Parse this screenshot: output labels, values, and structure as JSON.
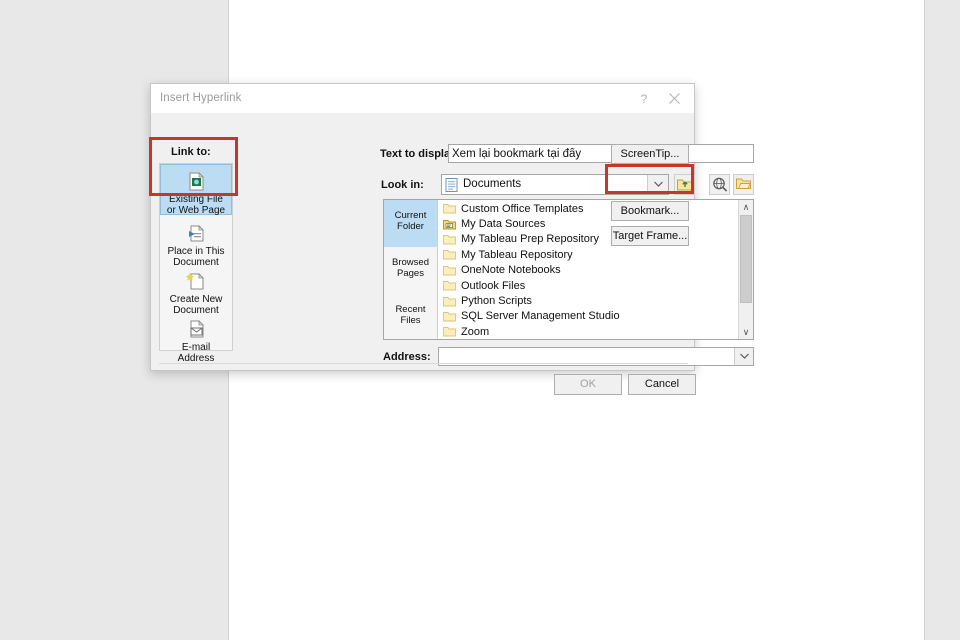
{
  "window": {
    "title": "Insert Hyperlink",
    "help_icon": "question-mark-icon",
    "help_label": "?",
    "close_icon": "close-icon"
  },
  "labels": {
    "link_to": "Link to:",
    "text_to_display": "Text to display:",
    "look_in": "Look in:",
    "address": "Address:"
  },
  "fields": {
    "text_to_display_value": "Xem lại bookmark tại đẩy",
    "text_to_display_placeholder": "",
    "look_in_value": "Documents",
    "address_value": "",
    "address_placeholder": ""
  },
  "link_to_items": [
    {
      "label_line1": "Existing File",
      "label_line2": "or Web Page",
      "icon": "existing-file-or-web-page-icon",
      "selected": true
    },
    {
      "label_line1": "Place in This",
      "label_line2": "Document",
      "icon": "place-in-this-document-icon",
      "selected": false
    },
    {
      "label_line1": "Create New",
      "label_line2": "Document",
      "icon": "create-new-document-icon",
      "selected": false
    },
    {
      "label_line1": "E-mail",
      "label_line2": "Address",
      "icon": "email-address-icon",
      "selected": false
    }
  ],
  "side_tabs": [
    {
      "line1": "Current",
      "line2": "Folder",
      "selected": true
    },
    {
      "line1": "Browsed",
      "line2": "Pages",
      "selected": false
    },
    {
      "line1": "Recent",
      "line2": "Files",
      "selected": false
    }
  ],
  "file_list": [
    {
      "name": "Custom Office Templates",
      "icon": "folder-icon"
    },
    {
      "name": "My Data Sources",
      "icon": "data-sources-folder-icon"
    },
    {
      "name": "My Tableau Prep Repository",
      "icon": "folder-icon"
    },
    {
      "name": "My Tableau Repository",
      "icon": "folder-icon"
    },
    {
      "name": "OneNote Notebooks",
      "icon": "folder-icon"
    },
    {
      "name": "Outlook Files",
      "icon": "folder-icon"
    },
    {
      "name": "Python Scripts",
      "icon": "folder-icon"
    },
    {
      "name": "SQL Server Management Studio",
      "icon": "folder-icon"
    },
    {
      "name": "Zoom",
      "icon": "folder-icon"
    }
  ],
  "toolbar_icons": [
    {
      "name": "up-one-folder-icon"
    },
    {
      "name": "browse-the-web-icon"
    },
    {
      "name": "browse-for-file-icon"
    }
  ],
  "buttons": {
    "screentip": "ScreenTip...",
    "bookmark": "Bookmark...",
    "target_frame": "Target Frame...",
    "ok": "OK",
    "cancel": "Cancel"
  },
  "scrollbar": {
    "up_arrow": "∧",
    "down_arrow": "∨"
  },
  "combo_arrow": "⌄",
  "colors": {
    "annotation_red": "#c0392b",
    "selection_blue": "#bcdcf4",
    "dialog_gray": "#f0f0f0",
    "folder_yellow": "#ffe9a8"
  }
}
